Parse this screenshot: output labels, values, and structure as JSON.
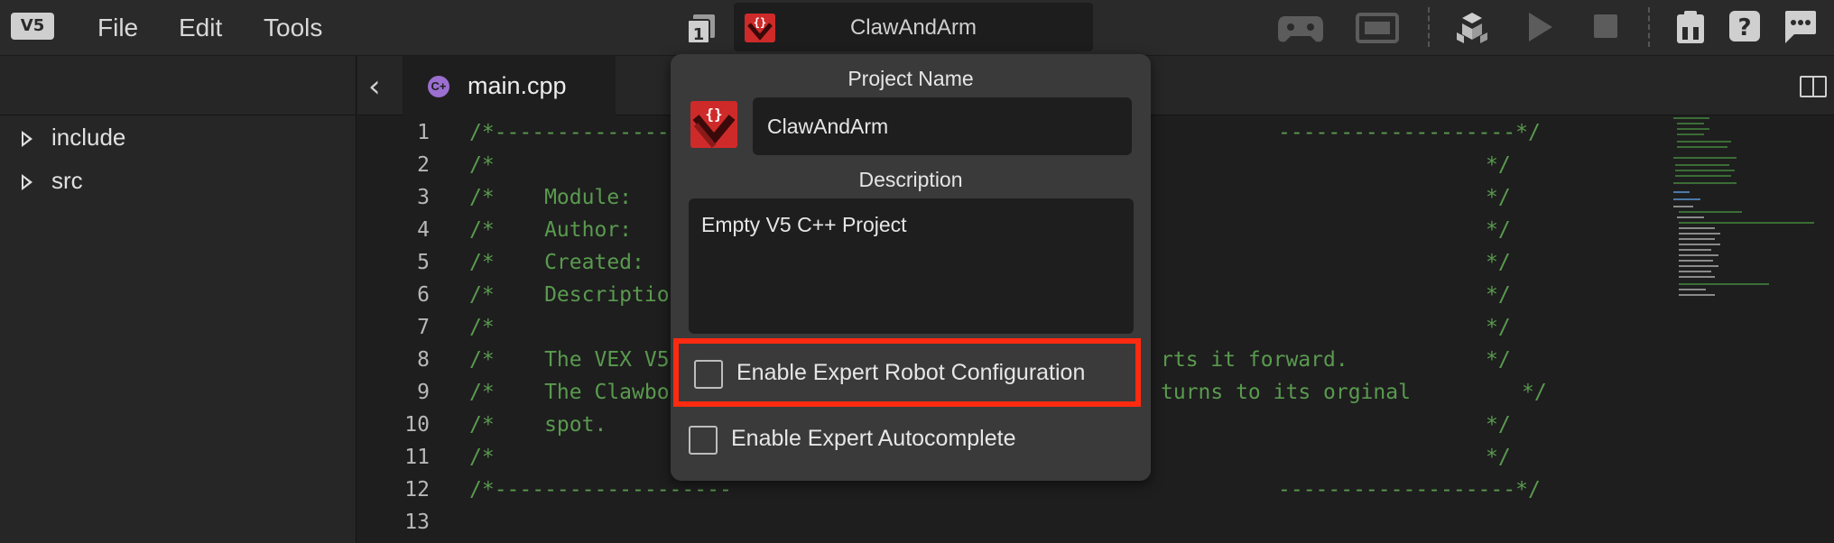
{
  "menubar": {
    "logo_text": "V5",
    "menu": [
      "File",
      "Edit",
      "Tools"
    ],
    "project_selector": {
      "name": "ClawAndArm"
    }
  },
  "toolbar": {
    "icons": [
      "controller-icon",
      "brain-screen-icon",
      "blocks-icon",
      "play-icon",
      "stop-icon",
      "device-info-icon",
      "help-icon",
      "feedback-icon"
    ]
  },
  "filetree": {
    "items": [
      "include",
      "src"
    ]
  },
  "editor": {
    "tab_label": "main.cpp",
    "line_numbers": [
      "1",
      "2",
      "3",
      "4",
      "5",
      "6",
      "7",
      "8",
      "9",
      "10",
      "11",
      "12",
      "13"
    ],
    "lines": [
      {
        "text": "/*-------------------",
        "end": "-------------------*/"
      },
      {
        "text": "/*",
        "end": "*/"
      },
      {
        "text": "/*    Module:",
        "end": "*/"
      },
      {
        "text": "/*    Author:",
        "end": "*/"
      },
      {
        "text": "/*    Created:",
        "end": "*/"
      },
      {
        "text": "/*    Descriptio",
        "end": "*/"
      },
      {
        "text": "/*",
        "end": "*/"
      },
      {
        "text": "/*    The VEX V5",
        "mid": "rts it forward.",
        "end": "*/"
      },
      {
        "text": "/*    The Clawbo",
        "mid": "turns to its orginal",
        "end": "*/"
      },
      {
        "text": "/*    spot.",
        "end": "*/"
      },
      {
        "text": "/*",
        "end": "*/"
      },
      {
        "text": "/*-------------------",
        "end": "-------------------*/"
      },
      {
        "text": "",
        "end": ""
      }
    ]
  },
  "popup": {
    "project_name_label": "Project Name",
    "project_name_value": "ClawAndArm",
    "description_label": "Description",
    "description_value": "Empty V5 C++ Project",
    "expert_robot_config_label": "Enable Expert Robot Configuration",
    "expert_robot_config_checked": false,
    "expert_autocomplete_label": "Enable Expert Autocomplete",
    "expert_autocomplete_checked": false
  },
  "colors": {
    "highlight_border": "#ff2a10",
    "comment_green": "#5a9a4f",
    "brand_red": "#cf2a2a"
  }
}
